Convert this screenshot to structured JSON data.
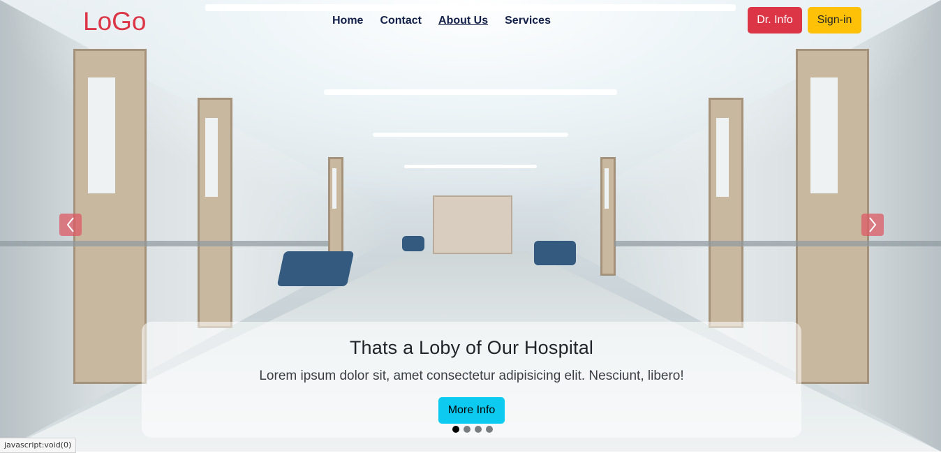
{
  "navbar": {
    "logo": "LoGo",
    "links": [
      {
        "label": "Home"
      },
      {
        "label": "Contact"
      },
      {
        "label": "About Us"
      },
      {
        "label": "Services"
      }
    ],
    "dr_info_label": "Dr. Info",
    "sign_in_label": "Sign-in"
  },
  "carousel": {
    "caption_title": "Thats a Loby of Our Hospital",
    "caption_text": "Lorem ipsum dolor sit, amet consectetur adipisicing elit. Nesciunt, libero!",
    "button_label": "More Info",
    "slide_count": 4,
    "active_slide": 1
  },
  "status_bar": {
    "text": "javascript:void(0)"
  },
  "colors": {
    "logo": "#dc3545",
    "danger_button": "#dc3545",
    "warning_button": "#ffc107",
    "info_button": "#0dcaf0",
    "nav_link": "#13214a"
  },
  "icons": {
    "prev": "chevron-left-icon",
    "next": "chevron-right-icon"
  }
}
